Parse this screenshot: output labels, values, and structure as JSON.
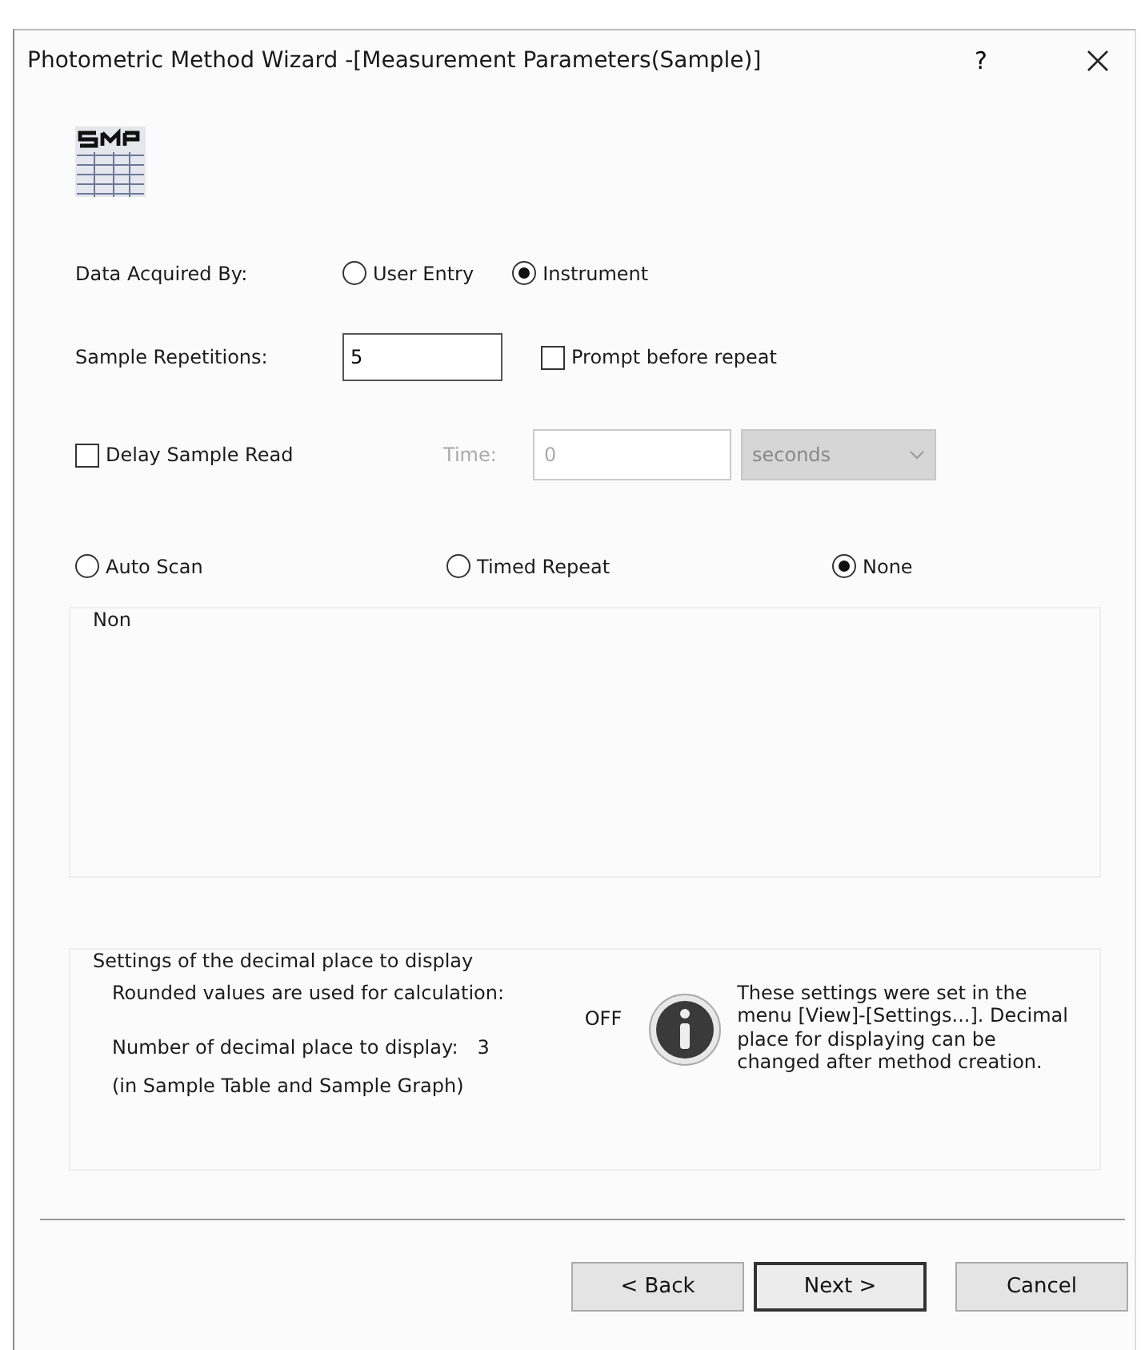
{
  "window": {
    "title": "Photometric Method Wizard -[Measurement Parameters(Sample)]",
    "help": "?"
  },
  "data_acquired_by": {
    "label": "Data Acquired By:",
    "options": [
      {
        "label": "User Entry",
        "selected": false
      },
      {
        "label": "Instrument",
        "selected": true
      }
    ]
  },
  "sample_repetitions": {
    "label": "Sample Repetitions:",
    "value": "5"
  },
  "prompt_before_repeat": {
    "label": "Prompt before repeat",
    "checked": false
  },
  "delay_sample_read": {
    "label": "Delay Sample Read",
    "checked": false
  },
  "time": {
    "label": "Time:",
    "value": "0",
    "disabled": true
  },
  "time_unit": {
    "value": "seconds",
    "disabled": true
  },
  "repeat_mode": {
    "options": [
      {
        "label": "Auto Scan",
        "selected": false
      },
      {
        "label": "Timed Repeat",
        "selected": false
      },
      {
        "label": "None",
        "selected": true
      }
    ]
  },
  "mode_group": {
    "label": "Non"
  },
  "decimal_settings": {
    "title": "Settings of the decimal place to display",
    "rounded_label": "Rounded values are used for calculation:",
    "rounded_value": "OFF",
    "decimals_label": "Number of decimal place to display:",
    "decimals_value": "3",
    "scope_note": "(in Sample Table and Sample Graph)",
    "info": "These settings were set in the menu [View]-[Settings...]. Decimal place for displaying can be changed after method creation."
  },
  "buttons": [
    {
      "label": "< Back",
      "default": false
    },
    {
      "label": "Next >",
      "default": true
    },
    {
      "label": "Cancel",
      "default": false
    }
  ]
}
